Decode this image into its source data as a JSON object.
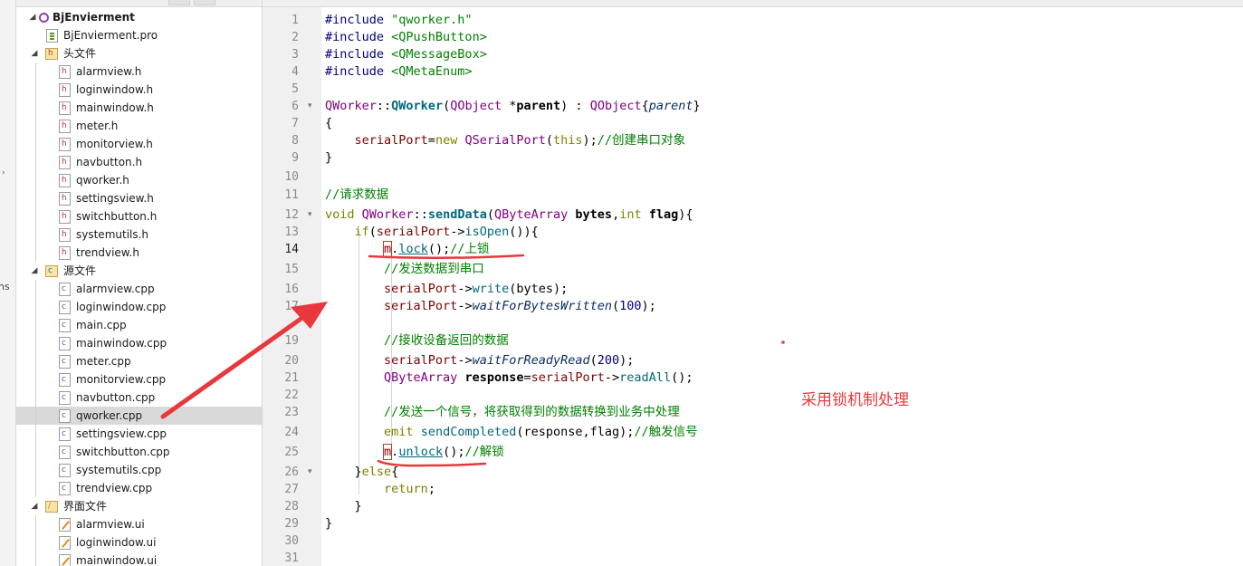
{
  "strip": {
    "fragment": "ns",
    "arrow": "›"
  },
  "tree": {
    "project": {
      "name": "BjEnvierment",
      "pro": "BjEnvierment.pro"
    },
    "headers": {
      "label": "头文件",
      "files": [
        "alarmview.h",
        "loginwindow.h",
        "mainwindow.h",
        "meter.h",
        "monitorview.h",
        "navbutton.h",
        "qworker.h",
        "settingsview.h",
        "switchbutton.h",
        "systemutils.h",
        "trendview.h"
      ]
    },
    "sources": {
      "label": "源文件",
      "files": [
        "alarmview.cpp",
        "loginwindow.cpp",
        "main.cpp",
        "mainwindow.cpp",
        "meter.cpp",
        "monitorview.cpp",
        "navbutton.cpp",
        "qworker.cpp",
        "settingsview.cpp",
        "switchbutton.cpp",
        "systemutils.cpp",
        "trendview.cpp"
      ],
      "selected": "qworker.cpp"
    },
    "forms": {
      "label": "界面文件",
      "files": [
        "alarmview.ui",
        "loginwindow.ui",
        "mainwindow.ui"
      ]
    }
  },
  "editor": {
    "current_line": 14,
    "line_numbers": [
      1,
      2,
      3,
      4,
      5,
      6,
      7,
      8,
      9,
      10,
      11,
      12,
      13,
      14,
      15,
      16,
      17,
      19,
      20,
      21,
      22,
      23,
      24,
      25,
      26,
      27,
      28,
      29,
      30,
      31
    ],
    "code": {
      "l1_dir": "#include",
      "l1_arg": " \"qworker.h\"",
      "l2_dir": "#include",
      "l2_arg": " <QPushButton>",
      "l3_dir": "#include",
      "l3_arg": " <QMessageBox>",
      "l4_dir": "#include",
      "l4_arg": " <QMetaEnum>",
      "l6_a": "QWorker",
      "l6_b": "::",
      "l6_c": "QWorker",
      "l6_d": "(",
      "l6_e": "QObject",
      "l6_f": " *",
      "l6_g": "parent",
      "l6_h": ") : ",
      "l6_i": "QObject",
      "l6_j": "{",
      "l6_k": "parent",
      "l6_l": "}",
      "l7": "{",
      "l8_a": "    serialPort",
      "l8_b": "=",
      "l8_c": "new",
      "l8_d": " ",
      "l8_e": "QSerialPort",
      "l8_f": "(",
      "l8_g": "this",
      "l8_h": ");",
      "l8_i": "//创建串口对象",
      "l9": "}",
      "l11": "//请求数据",
      "l12_a": "void",
      "l12_b": " ",
      "l12_c": "QWorker",
      "l12_d": "::",
      "l12_e": "sendData",
      "l12_f": "(",
      "l12_g": "QByteArray",
      "l12_h": " ",
      "l12_i": "bytes",
      "l12_j": ",",
      "l12_k": "int",
      "l12_l": " ",
      "l12_m": "flag",
      "l12_n": "){",
      "l13_a": "    ",
      "l13_b": "if",
      "l13_c": "(",
      "l13_d": "serialPort",
      "l13_e": "->",
      "l13_f": "isOpen",
      "l13_g": "()){",
      "l14_a": "        ",
      "l14_b": "m",
      "l14_c": ".",
      "l14_d": "lock",
      "l14_e": "();",
      "l14_f": "//上锁",
      "l15": "        //发送数据到串口",
      "l16_a": "        ",
      "l16_b": "serialPort",
      "l16_c": "->",
      "l16_d": "write",
      "l16_e": "(bytes);",
      "l17_a": "        ",
      "l17_b": "serialPort",
      "l17_c": "->",
      "l17_d": "waitForBytesWritten",
      "l17_e": "(",
      "l17_f": "100",
      "l17_g": ");",
      "l19": "        //接收设备返回的数据",
      "l20_a": "        ",
      "l20_b": "serialPort",
      "l20_c": "->",
      "l20_d": "waitForReadyRead",
      "l20_e": "(",
      "l20_f": "200",
      "l20_g": ");",
      "l21_a": "        ",
      "l21_b": "QByteArray",
      "l21_c": " ",
      "l21_d": "response",
      "l21_e": "=",
      "l21_f": "serialPort",
      "l21_g": "->",
      "l21_h": "readAll",
      "l21_i": "();",
      "l23": "        //发送一个信号，将获取得到的数据转换到业务中处理",
      "l24_a": "        ",
      "l24_b": "emit",
      "l24_c": " ",
      "l24_d": "sendCompleted",
      "l24_e": "(response,flag);",
      "l24_f": "//触发信号",
      "l25_a": "        ",
      "l25_b": "m",
      "l25_c": ".",
      "l25_d": "unlock",
      "l25_e": "();",
      "l25_f": "//解锁",
      "l26_a": "    }",
      "l26_b": "else",
      "l26_c": "{",
      "l27_a": "        ",
      "l27_b": "return",
      "l27_c": ";",
      "l28": "    }",
      "l29": "}"
    }
  },
  "annotation": {
    "text": "采用锁机制处理",
    "color": "#e8383d"
  },
  "colors": {
    "gutter_bg": "#f0f0f0",
    "selection_bg": "#d9d9d9",
    "comment": "#008000",
    "keyword": "#808000",
    "annotation_red": "#e8383d"
  }
}
